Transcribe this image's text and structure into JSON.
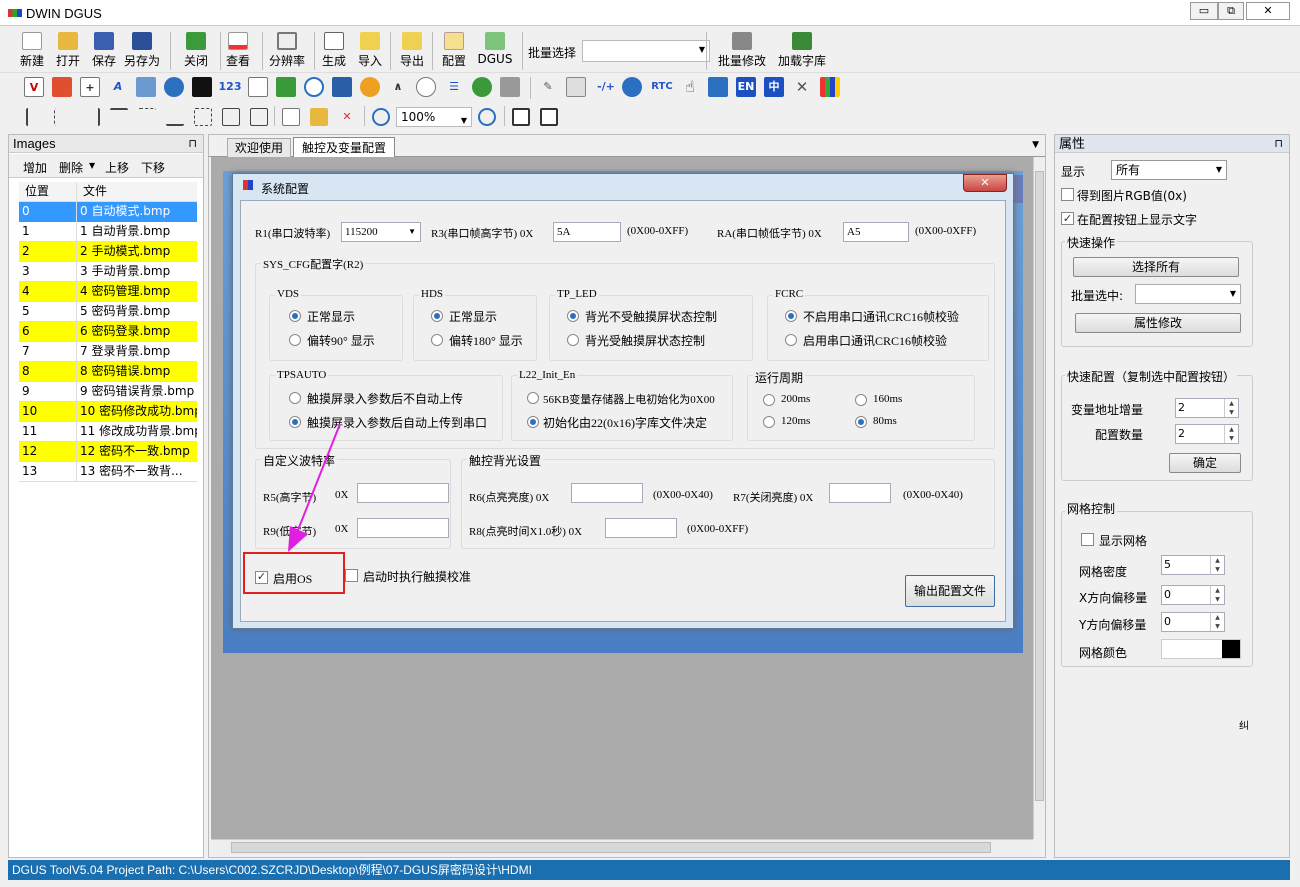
{
  "app": {
    "title": "DWIN DGUS"
  },
  "window_buttons": {
    "minimize": "▭",
    "restore": "⧉",
    "close": "✕"
  },
  "toolbar": {
    "new": "新建",
    "open": "打开",
    "save": "保存",
    "save_as": "另存为",
    "close": "关闭",
    "view": "查看",
    "resolution": "分辨率",
    "generate": "生成",
    "import": "导入",
    "export": "导出",
    "config": "配置",
    "dgus": "DGUS",
    "batch_select_label": "批量选择",
    "batch_modify": "批量修改",
    "load_font": "加载字库"
  },
  "toolbar2": {
    "num_icon": "123",
    "rtc_icon": "RTC",
    "en_icon": "EN",
    "zh_icon": "中",
    "plus_minus_icon": "-/+"
  },
  "toolbar3": {
    "zoom_value": "100%"
  },
  "images_panel": {
    "title": "Images",
    "actions": {
      "add": "增加",
      "delete": "删除",
      "up": "上移",
      "down": "下移"
    },
    "columns": {
      "pos": "位置",
      "file": "文件"
    },
    "rows": [
      {
        "pos": "0",
        "file": "0 自动模式.bmp",
        "style": "sel"
      },
      {
        "pos": "1",
        "file": "1 自动背景.bmp",
        "style": ""
      },
      {
        "pos": "2",
        "file": "2 手动模式.bmp",
        "style": "y"
      },
      {
        "pos": "3",
        "file": "3 手动背景.bmp",
        "style": ""
      },
      {
        "pos": "4",
        "file": "4 密码管理.bmp",
        "style": "y"
      },
      {
        "pos": "5",
        "file": "5 密码背景.bmp",
        "style": ""
      },
      {
        "pos": "6",
        "file": "6 密码登录.bmp",
        "style": "y"
      },
      {
        "pos": "7",
        "file": "7 登录背景.bmp",
        "style": ""
      },
      {
        "pos": "8",
        "file": "8 密码错误.bmp",
        "style": "y"
      },
      {
        "pos": "9",
        "file": "9 密码错误背景.bmp",
        "style": ""
      },
      {
        "pos": "10",
        "file": "10 密码修改成功.bmp",
        "style": "y"
      },
      {
        "pos": "11",
        "file": "11 修改成功背景.bmp",
        "style": ""
      },
      {
        "pos": "12",
        "file": "12 密码不一致.bmp",
        "style": "y"
      },
      {
        "pos": "13",
        "file": "13 密码不一致背...",
        "style": ""
      }
    ]
  },
  "tabs": {
    "welcome": "欢迎使用",
    "touch_config": "触控及变量配置"
  },
  "dialog": {
    "title": "系统配置",
    "close": "✕",
    "r1_label": "R1(串口波特率)",
    "r1_value": "115200",
    "r3_label": "R3(串口帧高字节) 0X",
    "r3_value": "5A",
    "r3_range": "(0X00-0XFF)",
    "ra_label": "RA(串口帧低字节)  0X",
    "ra_value": "A5",
    "ra_range": "(0X00-0XFF)",
    "sys_cfg_label": "SYS_CFG配置字(R2)",
    "vds": {
      "label": "VDS",
      "opt1": "正常显示",
      "opt2": "偏转90° 显示"
    },
    "hds": {
      "label": "HDS",
      "opt1": "正常显示",
      "opt2": "偏转180° 显示"
    },
    "tp_led": {
      "label": "TP_LED",
      "opt1": "背光不受触摸屏状态控制",
      "opt2": "背光受触摸屏状态控制"
    },
    "fcrc": {
      "label": "FCRC",
      "opt1": "不启用串口通讯CRC16帧校验",
      "opt2": "启用串口通讯CRC16帧校验"
    },
    "tpsauto": {
      "label": "TPSAUTO",
      "opt1": "触摸屏录入参数后不自动上传",
      "opt2": "触摸屏录入参数后自动上传到串口"
    },
    "l22": {
      "label": "L22_Init_En",
      "opt1": "56KB变量存储器上电初始化为0X00",
      "opt2": "初始化由22(0x16)字库文件决定"
    },
    "period": {
      "label": "运行周期",
      "o200": "200ms",
      "o160": "160ms",
      "o120": "120ms",
      "o80": "80ms"
    },
    "baud_custom": {
      "label": "自定义波特率",
      "r5": "R5(高字节)",
      "r9": "R9(低字节)",
      "hex": "0X"
    },
    "backlight": {
      "label": "触控背光设置",
      "r6": "R6(点亮亮度)  0X",
      "r6_range": "(0X00-0X40)",
      "r7": "R7(关闭亮度) 0X",
      "r7_range": "(0X00-0X40)",
      "r8": "R8(点亮时间X1.0秒) 0X",
      "r8_range": "(0X00-0XFF)"
    },
    "enable_os": "启用OS",
    "touch_calib": "启动时执行触摸校准",
    "export_btn": "输出配置文件"
  },
  "properties": {
    "title": "属性",
    "display_label": "显示",
    "display_value": "所有",
    "get_rgb": "得到图片RGB值(0x)",
    "show_text": "在配置按钮上显示文字",
    "quick_ops": "快速操作",
    "select_all": "选择所有",
    "batch_select": "批量选中:",
    "attr_modify": "属性修改",
    "quick_config": "快速配置（复制选中配置按钮）",
    "var_addr_inc": "变量地址增量",
    "var_addr_val": "2",
    "config_count": "配置数量",
    "config_count_val": "2",
    "confirm": "确定",
    "grid_ctrl": "网格控制",
    "show_grid": "显示网格",
    "grid_density": "网格密度",
    "grid_density_val": "5",
    "x_offset": "X方向偏移量",
    "x_offset_val": "0",
    "y_offset": "Y方向偏移量",
    "y_offset_val": "0",
    "grid_color": "网格颜色",
    "grid_color_hex": "#000000",
    "stray_char": "纠"
  },
  "statusbar": {
    "text": "DGUS ToolV5.04  Project Path: C:\\Users\\C002.SZCRJD\\Desktop\\例程\\07-DGUS屏密码设计\\HDMI"
  },
  "colors": {
    "accent": "#3399ff",
    "highlight_row": "#ffff00",
    "annotation": "#e020e0",
    "statusbar": "#1a6fb0"
  }
}
